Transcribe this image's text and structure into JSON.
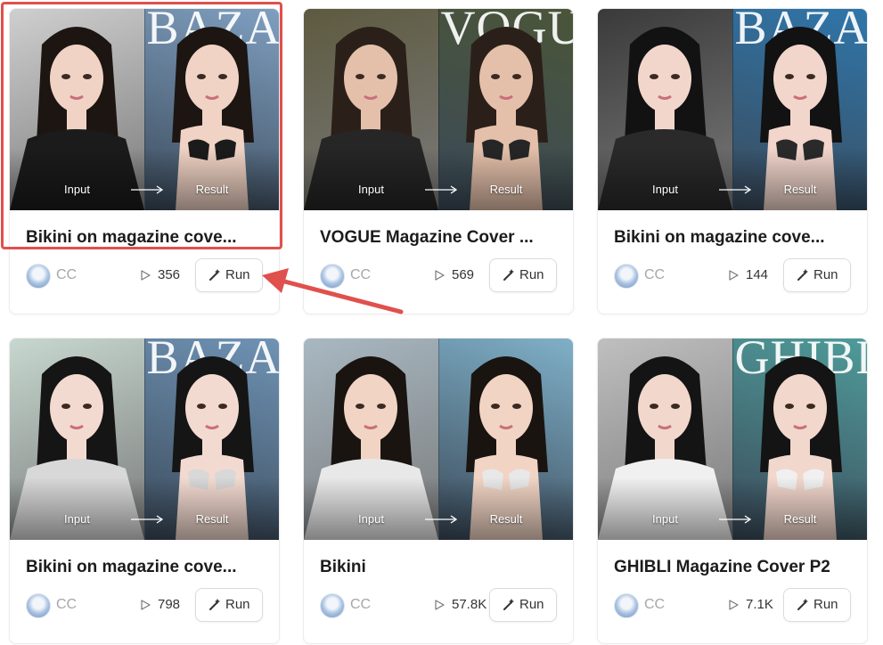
{
  "labels": {
    "input": "Input",
    "result": "Result",
    "run": "Run"
  },
  "colors": {
    "highlight": "#e0504c",
    "arrow": "#e0504c"
  },
  "cards": [
    {
      "title": "Bikini on magazine cove...",
      "author": "CC",
      "runs": "356",
      "masthead": "BAZAAR",
      "input_bg": "#cfcfcf",
      "result_bg": "#7f9fc0",
      "skin": "#f0d3c4",
      "hair": "#1d1512",
      "outfit": "#1b1b1b",
      "highlighted": true
    },
    {
      "title": "VOGUE Magazine Cover ...",
      "author": "CC",
      "runs": "569",
      "masthead": "VOGUE",
      "input_bg": "#5e5a40",
      "result_bg": "#4a5538",
      "skin": "#e4c0aa",
      "hair": "#2b2019",
      "outfit": "#262626",
      "highlighted": false
    },
    {
      "title": "Bikini on magazine cove...",
      "author": "CC",
      "runs": "144",
      "masthead": "BAZAAR",
      "input_bg": "#3a3a3a",
      "result_bg": "#2f76aa",
      "skin": "#f2d6cc",
      "hair": "#121212",
      "outfit": "#2a2a2a",
      "highlighted": false
    },
    {
      "title": "Bikini on magazine cove...",
      "author": "CC",
      "runs": "798",
      "masthead": "BAZAAR",
      "input_bg": "#c7d8d0",
      "result_bg": "#6f93b5",
      "skin": "#f3dad0",
      "hair": "#151515",
      "outfit": "#d8d8d8",
      "highlighted": false
    },
    {
      "title": "Bikini",
      "author": "CC",
      "runs": "57.8K",
      "masthead": "",
      "input_bg": "#a8b8c2",
      "result_bg": "#7fb0c8",
      "skin": "#f1d4c4",
      "hair": "#1a1410",
      "outfit": "#e8e8e8",
      "highlighted": false
    },
    {
      "title": "GHIBLI Magazine Cover P2",
      "author": "CC",
      "runs": "7.1K",
      "masthead": "GHIBLI",
      "input_bg": "#bfbfbf",
      "result_bg": "#4f9b9a",
      "skin": "#f2d7cc",
      "hair": "#141414",
      "outfit": "#f0f0f0",
      "highlighted": false
    }
  ]
}
